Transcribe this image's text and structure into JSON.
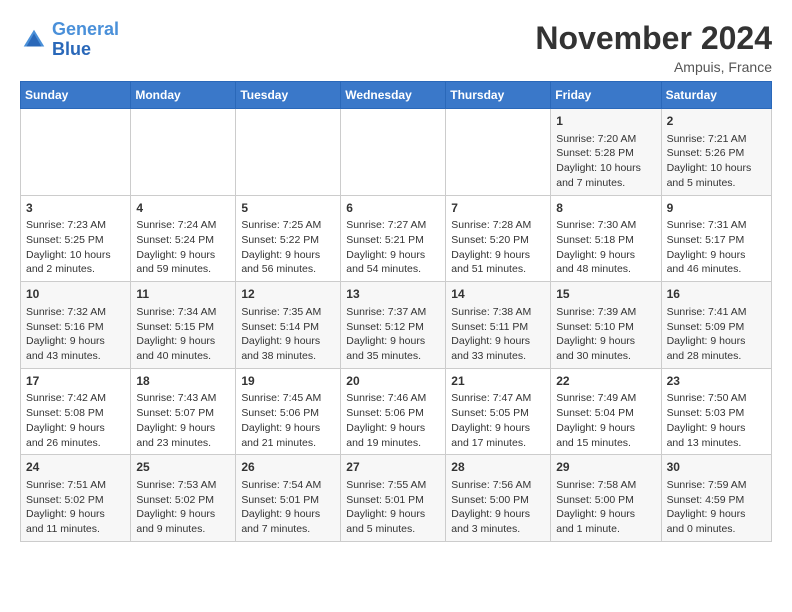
{
  "header": {
    "logo_line1": "General",
    "logo_line2": "Blue",
    "title": "November 2024",
    "location": "Ampuis, France"
  },
  "weekdays": [
    "Sunday",
    "Monday",
    "Tuesday",
    "Wednesday",
    "Thursday",
    "Friday",
    "Saturday"
  ],
  "weeks": [
    [
      {
        "day": "",
        "info": ""
      },
      {
        "day": "",
        "info": ""
      },
      {
        "day": "",
        "info": ""
      },
      {
        "day": "",
        "info": ""
      },
      {
        "day": "",
        "info": ""
      },
      {
        "day": "1",
        "info": "Sunrise: 7:20 AM\nSunset: 5:28 PM\nDaylight: 10 hours\nand 7 minutes."
      },
      {
        "day": "2",
        "info": "Sunrise: 7:21 AM\nSunset: 5:26 PM\nDaylight: 10 hours\nand 5 minutes."
      }
    ],
    [
      {
        "day": "3",
        "info": "Sunrise: 7:23 AM\nSunset: 5:25 PM\nDaylight: 10 hours\nand 2 minutes."
      },
      {
        "day": "4",
        "info": "Sunrise: 7:24 AM\nSunset: 5:24 PM\nDaylight: 9 hours\nand 59 minutes."
      },
      {
        "day": "5",
        "info": "Sunrise: 7:25 AM\nSunset: 5:22 PM\nDaylight: 9 hours\nand 56 minutes."
      },
      {
        "day": "6",
        "info": "Sunrise: 7:27 AM\nSunset: 5:21 PM\nDaylight: 9 hours\nand 54 minutes."
      },
      {
        "day": "7",
        "info": "Sunrise: 7:28 AM\nSunset: 5:20 PM\nDaylight: 9 hours\nand 51 minutes."
      },
      {
        "day": "8",
        "info": "Sunrise: 7:30 AM\nSunset: 5:18 PM\nDaylight: 9 hours\nand 48 minutes."
      },
      {
        "day": "9",
        "info": "Sunrise: 7:31 AM\nSunset: 5:17 PM\nDaylight: 9 hours\nand 46 minutes."
      }
    ],
    [
      {
        "day": "10",
        "info": "Sunrise: 7:32 AM\nSunset: 5:16 PM\nDaylight: 9 hours\nand 43 minutes."
      },
      {
        "day": "11",
        "info": "Sunrise: 7:34 AM\nSunset: 5:15 PM\nDaylight: 9 hours\nand 40 minutes."
      },
      {
        "day": "12",
        "info": "Sunrise: 7:35 AM\nSunset: 5:14 PM\nDaylight: 9 hours\nand 38 minutes."
      },
      {
        "day": "13",
        "info": "Sunrise: 7:37 AM\nSunset: 5:12 PM\nDaylight: 9 hours\nand 35 minutes."
      },
      {
        "day": "14",
        "info": "Sunrise: 7:38 AM\nSunset: 5:11 PM\nDaylight: 9 hours\nand 33 minutes."
      },
      {
        "day": "15",
        "info": "Sunrise: 7:39 AM\nSunset: 5:10 PM\nDaylight: 9 hours\nand 30 minutes."
      },
      {
        "day": "16",
        "info": "Sunrise: 7:41 AM\nSunset: 5:09 PM\nDaylight: 9 hours\nand 28 minutes."
      }
    ],
    [
      {
        "day": "17",
        "info": "Sunrise: 7:42 AM\nSunset: 5:08 PM\nDaylight: 9 hours\nand 26 minutes."
      },
      {
        "day": "18",
        "info": "Sunrise: 7:43 AM\nSunset: 5:07 PM\nDaylight: 9 hours\nand 23 minutes."
      },
      {
        "day": "19",
        "info": "Sunrise: 7:45 AM\nSunset: 5:06 PM\nDaylight: 9 hours\nand 21 minutes."
      },
      {
        "day": "20",
        "info": "Sunrise: 7:46 AM\nSunset: 5:06 PM\nDaylight: 9 hours\nand 19 minutes."
      },
      {
        "day": "21",
        "info": "Sunrise: 7:47 AM\nSunset: 5:05 PM\nDaylight: 9 hours\nand 17 minutes."
      },
      {
        "day": "22",
        "info": "Sunrise: 7:49 AM\nSunset: 5:04 PM\nDaylight: 9 hours\nand 15 minutes."
      },
      {
        "day": "23",
        "info": "Sunrise: 7:50 AM\nSunset: 5:03 PM\nDaylight: 9 hours\nand 13 minutes."
      }
    ],
    [
      {
        "day": "24",
        "info": "Sunrise: 7:51 AM\nSunset: 5:02 PM\nDaylight: 9 hours\nand 11 minutes."
      },
      {
        "day": "25",
        "info": "Sunrise: 7:53 AM\nSunset: 5:02 PM\nDaylight: 9 hours\nand 9 minutes."
      },
      {
        "day": "26",
        "info": "Sunrise: 7:54 AM\nSunset: 5:01 PM\nDaylight: 9 hours\nand 7 minutes."
      },
      {
        "day": "27",
        "info": "Sunrise: 7:55 AM\nSunset: 5:01 PM\nDaylight: 9 hours\nand 5 minutes."
      },
      {
        "day": "28",
        "info": "Sunrise: 7:56 AM\nSunset: 5:00 PM\nDaylight: 9 hours\nand 3 minutes."
      },
      {
        "day": "29",
        "info": "Sunrise: 7:58 AM\nSunset: 5:00 PM\nDaylight: 9 hours\nand 1 minute."
      },
      {
        "day": "30",
        "info": "Sunrise: 7:59 AM\nSunset: 4:59 PM\nDaylight: 9 hours\nand 0 minutes."
      }
    ]
  ]
}
